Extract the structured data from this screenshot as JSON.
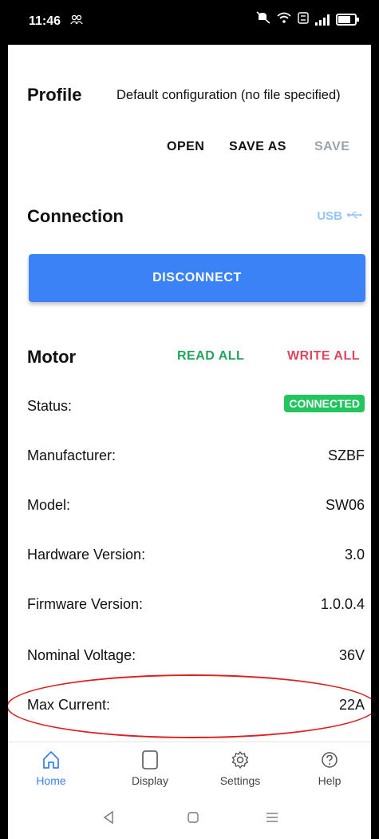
{
  "status_bar": {
    "time": "11:46",
    "notif_icon": "people-icon"
  },
  "profile": {
    "title": "Profile",
    "description": "Default configuration (no file specified)",
    "open_label": "OPEN",
    "save_as_label": "SAVE AS",
    "save_label": "SAVE"
  },
  "connection": {
    "title": "Connection",
    "usb_label": "USB",
    "disconnect_label": "DISCONNECT"
  },
  "motor": {
    "title": "Motor",
    "read_all_label": "READ ALL",
    "write_all_label": "WRITE ALL",
    "rows": [
      {
        "label": "Status:",
        "value": "CONNECTED"
      },
      {
        "label": "Manufacturer:",
        "value": "SZBF"
      },
      {
        "label": "Model:",
        "value": "SW06"
      },
      {
        "label": "Hardware Version:",
        "value": "3.0"
      },
      {
        "label": "Firmware Version:",
        "value": "1.0.0.4"
      },
      {
        "label": "Nominal Voltage:",
        "value": "36V"
      },
      {
        "label": "Max Current:",
        "value": "22A"
      }
    ]
  },
  "nav": {
    "items": [
      {
        "label": "Home",
        "icon": "home-icon"
      },
      {
        "label": "Display",
        "icon": "display-icon"
      },
      {
        "label": "Settings",
        "icon": "gear-icon"
      },
      {
        "label": "Help",
        "icon": "help-icon"
      }
    ]
  },
  "colors": {
    "primary": "#3b82f6",
    "read": "#22a55a",
    "write": "#e0455e",
    "disabled": "#9ca3af",
    "connected": "#22c55e",
    "usb": "#93c5fd"
  }
}
